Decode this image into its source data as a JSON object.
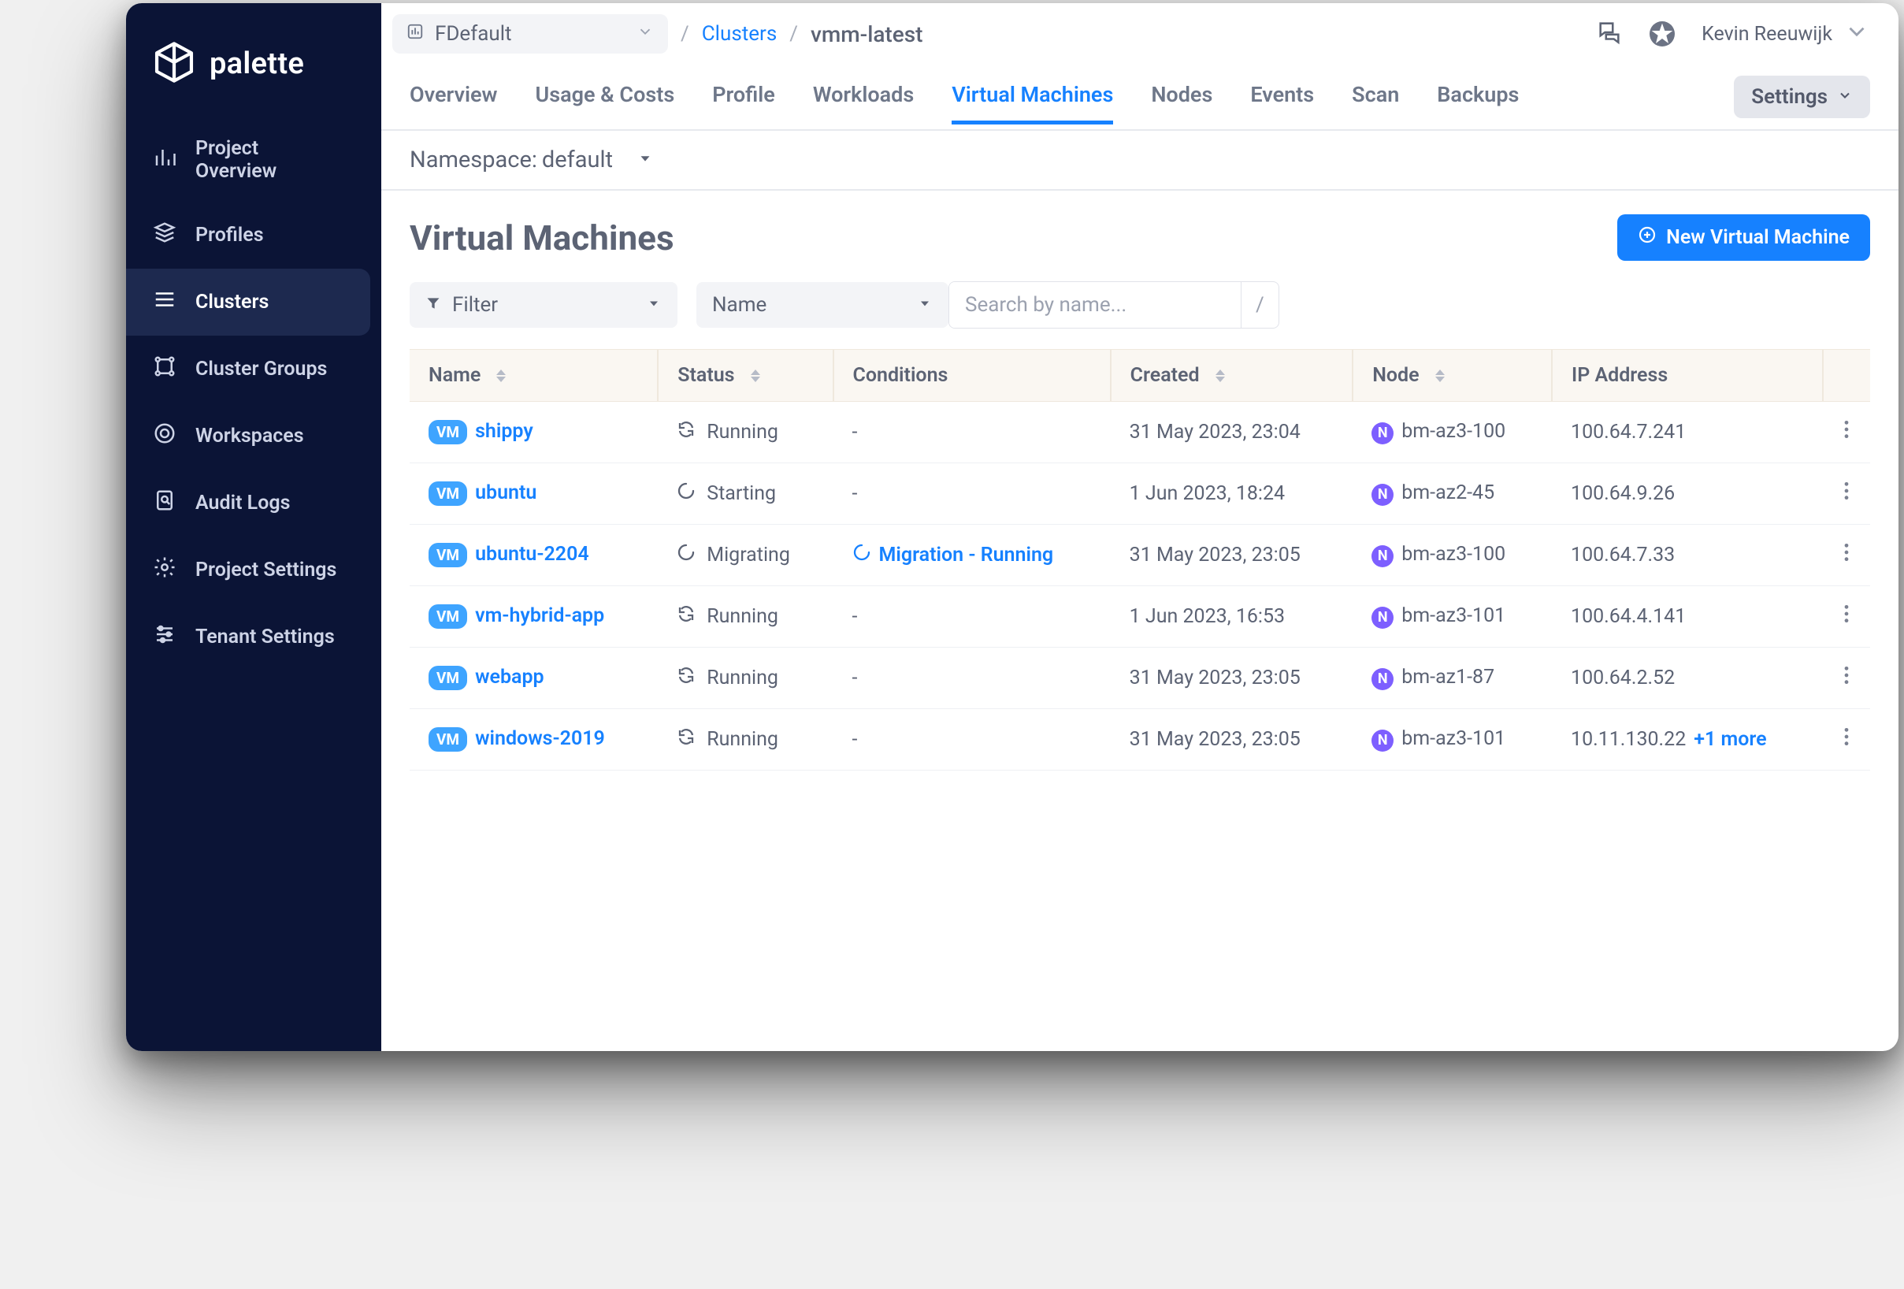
{
  "logo_text": "palette",
  "sidebar": {
    "items": [
      {
        "label": "Project Overview"
      },
      {
        "label": "Profiles"
      },
      {
        "label": "Clusters"
      },
      {
        "label": "Cluster Groups"
      },
      {
        "label": "Workspaces"
      },
      {
        "label": "Audit Logs"
      },
      {
        "label": "Project Settings"
      },
      {
        "label": "Tenant Settings"
      }
    ],
    "active": "Clusters"
  },
  "header": {
    "project_selector": "FDefault",
    "breadcrumb_link": "Clusters",
    "breadcrumb_current": "vmm-latest",
    "user_name": "Kevin Reeuwijk"
  },
  "tabs": {
    "items": [
      "Overview",
      "Usage & Costs",
      "Profile",
      "Workloads",
      "Virtual Machines",
      "Nodes",
      "Events",
      "Scan",
      "Backups"
    ],
    "active": "Virtual Machines",
    "settings_label": "Settings"
  },
  "namespace_bar": {
    "label": "Namespace: ",
    "value": "default"
  },
  "page_title": "Virtual Machines",
  "new_vm_button": "New Virtual Machine",
  "filters": {
    "filter_label": "Filter",
    "field_label": "Name",
    "search_placeholder": "Search by name...",
    "search_divider": "/"
  },
  "table": {
    "columns": [
      "Name",
      "Status",
      "Conditions",
      "Created",
      "Node",
      "IP Address",
      ""
    ],
    "sortable": {
      "Name": true,
      "Status": true,
      "Created": true,
      "Node": true
    },
    "rows": [
      {
        "vm_badge": "VM",
        "name": "shippy",
        "status_icon": "sync",
        "status": "Running",
        "condition": "-",
        "condition_active": false,
        "created": "31 May 2023, 23:04",
        "node_badge": "N",
        "node": "bm-az3-100",
        "ip": "100.64.7.241",
        "ip_extra": ""
      },
      {
        "vm_badge": "VM",
        "name": "ubuntu",
        "status_icon": "spinner",
        "status": "Starting",
        "condition": "-",
        "condition_active": false,
        "created": "1 Jun 2023, 18:24",
        "node_badge": "N",
        "node": "bm-az2-45",
        "ip": "100.64.9.26",
        "ip_extra": ""
      },
      {
        "vm_badge": "VM",
        "name": "ubuntu-2204",
        "status_icon": "spinner",
        "status": "Migrating",
        "condition": "Migration - Running",
        "condition_active": true,
        "created": "31 May 2023, 23:05",
        "node_badge": "N",
        "node": "bm-az3-100",
        "ip": "100.64.7.33",
        "ip_extra": ""
      },
      {
        "vm_badge": "VM",
        "name": "vm-hybrid-app",
        "status_icon": "sync",
        "status": "Running",
        "condition": "-",
        "condition_active": false,
        "created": "1 Jun 2023, 16:53",
        "node_badge": "N",
        "node": "bm-az3-101",
        "ip": "100.64.4.141",
        "ip_extra": ""
      },
      {
        "vm_badge": "VM",
        "name": "webapp",
        "status_icon": "sync",
        "status": "Running",
        "condition": "-",
        "condition_active": false,
        "created": "31 May 2023, 23:05",
        "node_badge": "N",
        "node": "bm-az1-87",
        "ip": "100.64.2.52",
        "ip_extra": ""
      },
      {
        "vm_badge": "VM",
        "name": "windows-2019",
        "status_icon": "sync",
        "status": "Running",
        "condition": "-",
        "condition_active": false,
        "created": "31 May 2023, 23:05",
        "node_badge": "N",
        "node": "bm-az3-101",
        "ip": "10.11.130.22",
        "ip_extra": "+1 more"
      }
    ]
  }
}
